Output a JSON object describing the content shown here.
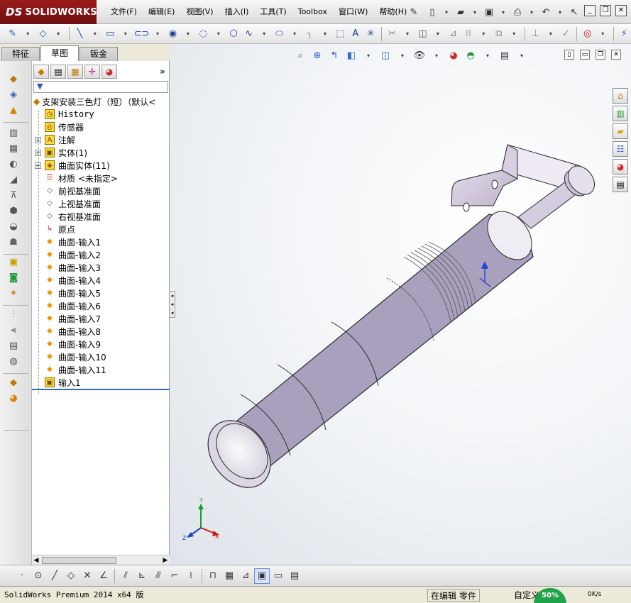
{
  "app": {
    "brand_prefix": "DS",
    "brand": "SOLIDWORKS"
  },
  "menu": [
    "文件(F)",
    "编辑(E)",
    "视图(V)",
    "插入(I)",
    "工具(T)",
    "Toolbox",
    "窗口(W)",
    "帮助(H)"
  ],
  "title_tools": {
    "help": "?"
  },
  "tabs": [
    "特征",
    "草图",
    "钣金"
  ],
  "active_tab": "草图",
  "panel": {
    "more": "»",
    "tree_root": "支架安装三色灯（短）（默认<",
    "nodes": [
      {
        "label": "History",
        "icon": "history-icon",
        "expandable": false
      },
      {
        "label": "传感器",
        "icon": "sensor-icon",
        "expandable": false
      },
      {
        "label": "注解",
        "icon": "annotation-icon",
        "expandable": true
      },
      {
        "label": "实体(1)",
        "icon": "solid-body-icon",
        "expandable": true
      },
      {
        "label": "曲面实体(11)",
        "icon": "surface-body-icon",
        "expandable": true
      },
      {
        "label": "材质 <未指定>",
        "icon": "material-icon",
        "expandable": false
      },
      {
        "label": "前视基准面",
        "icon": "plane-icon",
        "expandable": false
      },
      {
        "label": "上视基准面",
        "icon": "plane-icon",
        "expandable": false
      },
      {
        "label": "右视基准面",
        "icon": "plane-icon",
        "expandable": false
      },
      {
        "label": "原点",
        "icon": "origin-icon",
        "expandable": false
      },
      {
        "label": "曲面-输入1",
        "icon": "surface-import-icon",
        "expandable": false
      },
      {
        "label": "曲面-输入2",
        "icon": "surface-import-icon",
        "expandable": false
      },
      {
        "label": "曲面-输入3",
        "icon": "surface-import-icon",
        "expandable": false
      },
      {
        "label": "曲面-输入4",
        "icon": "surface-import-icon",
        "expandable": false
      },
      {
        "label": "曲面-输入5",
        "icon": "surface-import-icon",
        "expandable": false
      },
      {
        "label": "曲面-输入6",
        "icon": "surface-import-icon",
        "expandable": false
      },
      {
        "label": "曲面-输入7",
        "icon": "surface-import-icon",
        "expandable": false
      },
      {
        "label": "曲面-输入8",
        "icon": "surface-import-icon",
        "expandable": false
      },
      {
        "label": "曲面-输入9",
        "icon": "surface-import-icon",
        "expandable": false
      },
      {
        "label": "曲面-输入10",
        "icon": "surface-import-icon",
        "expandable": false
      },
      {
        "label": "曲面-输入11",
        "icon": "surface-import-icon",
        "expandable": false
      },
      {
        "label": "输入1",
        "icon": "import-icon",
        "expandable": false
      }
    ]
  },
  "triad": {
    "x": "X",
    "y": "Y",
    "z": "Z"
  },
  "status": {
    "product": "SolidWorks Premium 2014 x64 版",
    "mode": "在编辑 零件",
    "custom": "自定义",
    "cpu": "50%",
    "net": "0K/s"
  }
}
